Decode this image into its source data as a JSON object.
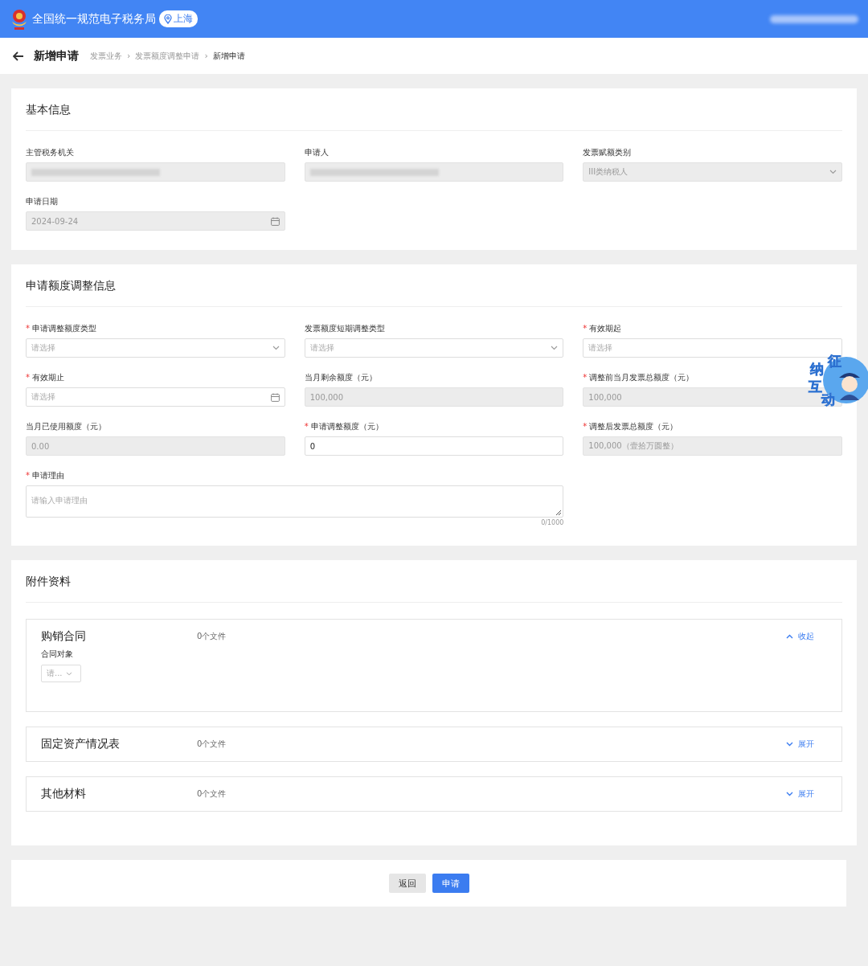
{
  "header": {
    "title": "全国统一规范电子税务局",
    "location": "上海"
  },
  "required_mark": "*",
  "page": {
    "title": "新增申请",
    "separator": "›",
    "breadcrumb": [
      {
        "label": "发票业务",
        "current": false
      },
      {
        "label": "发票额度调整申请",
        "current": false
      },
      {
        "label": "新增申请",
        "current": true
      }
    ]
  },
  "basic_info": {
    "title": "基本信息",
    "fields": [
      {
        "label": "主管税务机关",
        "kind": "masked",
        "required": false,
        "disabled": true
      },
      {
        "label": "申请人",
        "kind": "masked",
        "required": false,
        "disabled": true
      },
      {
        "label": "发票赋额类别",
        "kind": "select",
        "value": "III类纳税人",
        "required": false,
        "disabled": true
      },
      {
        "label": "申请日期",
        "kind": "date",
        "value": "2024-09-24",
        "required": false,
        "disabled": true
      }
    ]
  },
  "adjust_info": {
    "title": "申请额度调整信息",
    "fields": [
      {
        "label": "申请调整额度类型",
        "kind": "select",
        "placeholder": "请选择",
        "required": true,
        "disabled": false
      },
      {
        "label": "发票额度短期调整类型",
        "kind": "select",
        "placeholder": "请选择",
        "required": false,
        "disabled": false
      },
      {
        "label": "有效期起",
        "kind": "text",
        "placeholder": "请选择",
        "required": true,
        "disabled": false
      },
      {
        "label": "有效期止",
        "kind": "date",
        "placeholder": "请选择",
        "required": true,
        "disabled": false
      },
      {
        "label": "当月剩余额度（元）",
        "kind": "text",
        "value": "100,000",
        "required": false,
        "disabled": true
      },
      {
        "label": "调整前当月发票总额度（元）",
        "kind": "text",
        "value": "100,000",
        "required": true,
        "disabled": true
      },
      {
        "label": "当月已使用额度（元）",
        "kind": "text",
        "value": "0.00",
        "required": false,
        "disabled": true
      },
      {
        "label": "申请调整额度（元）",
        "kind": "text",
        "value": "0",
        "required": true,
        "disabled": false
      },
      {
        "label": "调整后发票总额度（元）",
        "kind": "text",
        "value": "100,000（壹拾万圆整）",
        "required": true,
        "disabled": true
      },
      {
        "label": "申请理由",
        "kind": "textarea",
        "placeholder": "请输入申请理由",
        "counter": "0/1000",
        "required": true,
        "disabled": false
      }
    ]
  },
  "attachments": {
    "title": "附件资料",
    "sections": [
      {
        "title": "购销合同",
        "count": "0个文件",
        "toggle": "收起",
        "expanded": true,
        "field": {
          "label": "合同对象",
          "placeholder": "请..."
        }
      },
      {
        "title": "固定资产情况表",
        "count": "0个文件",
        "toggle": "展开",
        "expanded": false
      },
      {
        "title": "其他材料",
        "count": "0个文件",
        "toggle": "展开",
        "expanded": false
      }
    ]
  },
  "assistant_badge": {
    "chars": [
      "征",
      "纳",
      "互",
      "动"
    ]
  },
  "buttons": [
    {
      "label": "返回",
      "kind": "secondary"
    },
    {
      "label": "申请",
      "kind": "primary"
    }
  ]
}
